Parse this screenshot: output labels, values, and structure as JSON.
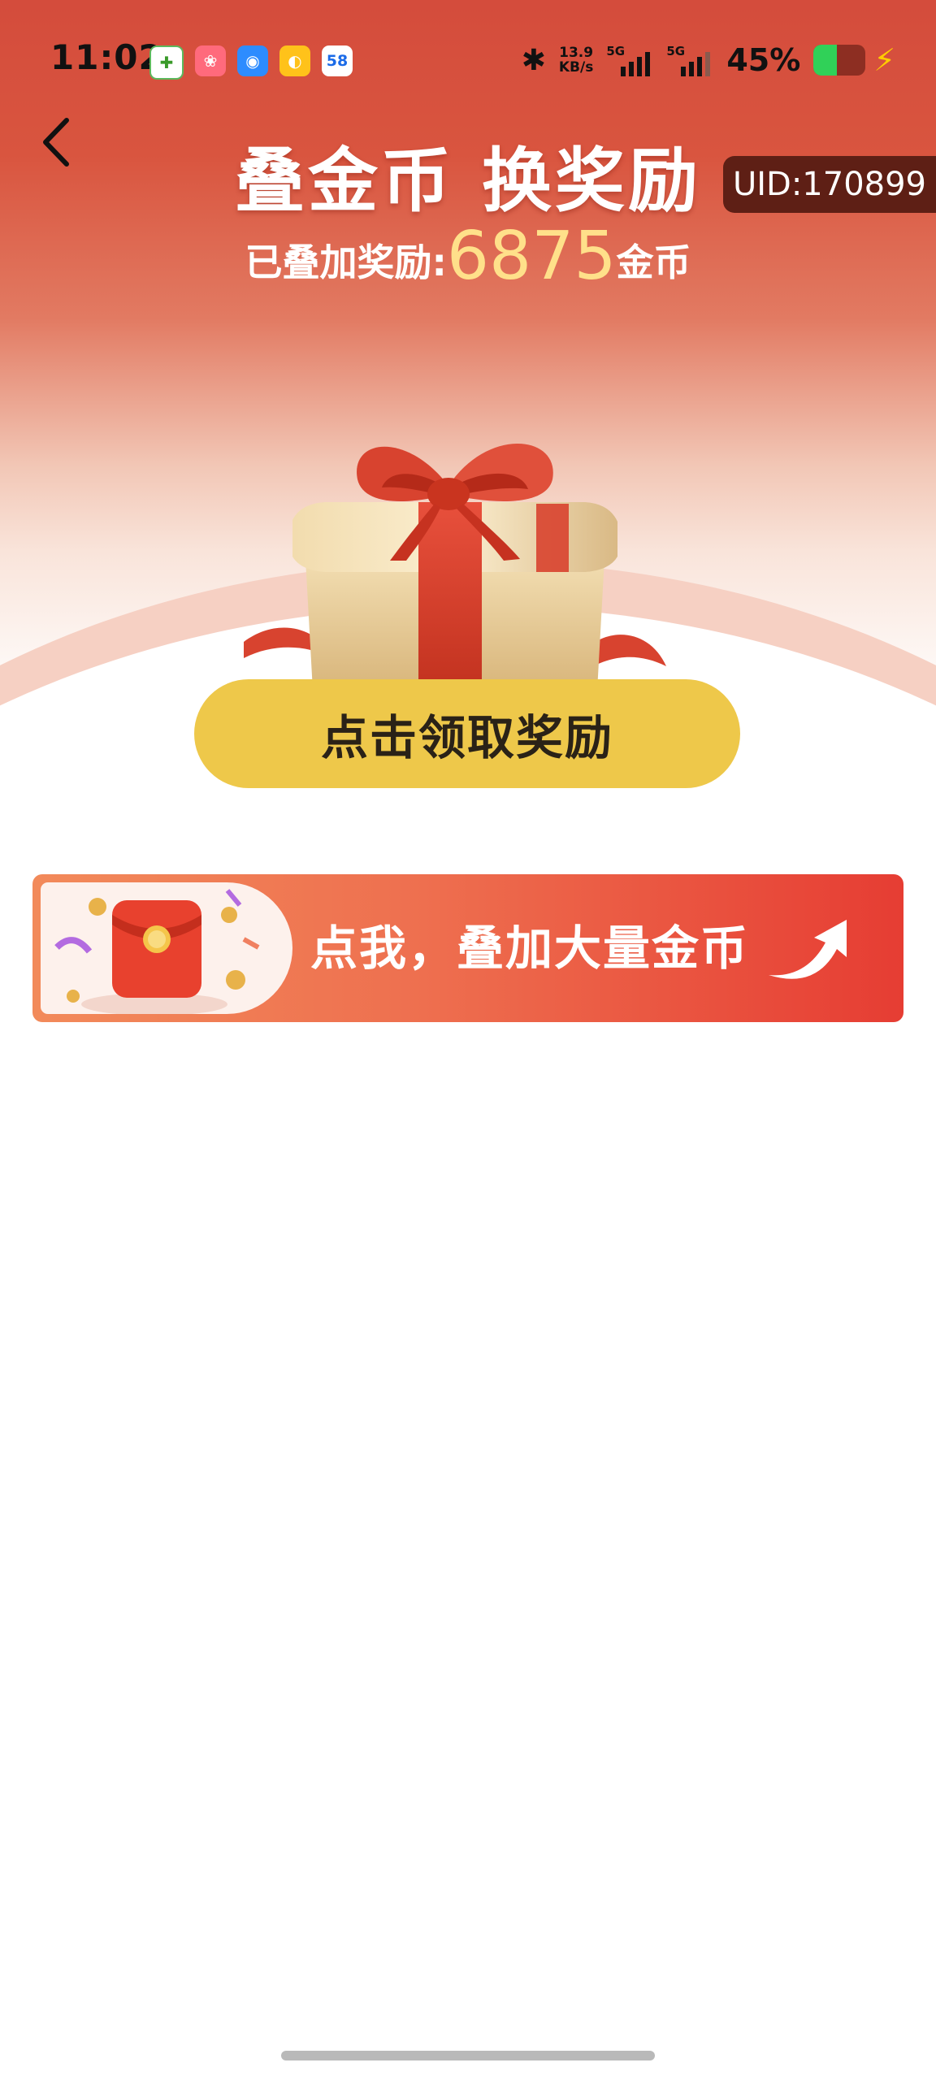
{
  "status_bar": {
    "time": "11:02",
    "app_icons": [
      "app-icon-1",
      "app-icon-2",
      "app-icon-3",
      "app-icon-4",
      "58"
    ],
    "net_speed_value": "13.9",
    "net_speed_unit": "KB/s",
    "sim1_label": "5G",
    "sim2_label": "5G",
    "battery_percent": "45%",
    "battery_level": 0.45
  },
  "header": {
    "back_icon": "chevron-left-icon",
    "title": "叠金币 换奖励",
    "uid": "UID:170899",
    "stacked_prefix": "已叠加奖励:",
    "stacked_amount": "6875",
    "stacked_unit": "金币"
  },
  "gift_image": "gift-box-illustration",
  "claim_button": {
    "label": "点击领取奖励",
    "color": "#eec84a"
  },
  "banner": {
    "text": "点我，叠加大量金币",
    "thumb_image": "red-envelope-illustration",
    "arrow_icon": "curved-arrow-icon"
  },
  "colors": {
    "header_red": "#d44c3c",
    "uid_bg": "#5e1f15",
    "amount_gold": "#ffe08a"
  }
}
